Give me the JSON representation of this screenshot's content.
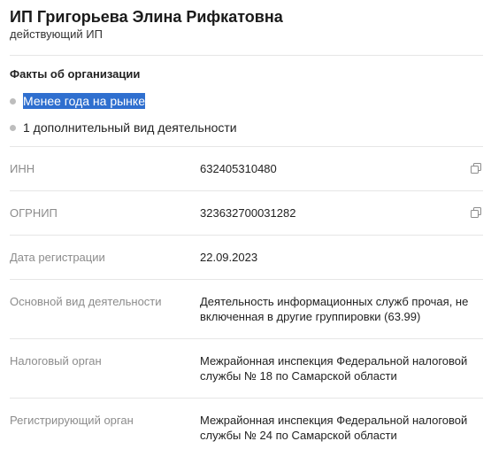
{
  "header": {
    "name": "ИП Григорьева Элина Рифкатовна",
    "status": "действующий ИП"
  },
  "facts": {
    "title": "Факты об организации",
    "items": [
      {
        "text": "Менее года на рынке",
        "selected": true
      },
      {
        "text": "1 дополнительный вид деятельности",
        "selected": false
      }
    ]
  },
  "details": {
    "inn_label": "ИНН",
    "inn_value": "632405310480",
    "ogrnip_label": "ОГРНИП",
    "ogrnip_value": "323632700031282",
    "reg_date_label": "Дата регистрации",
    "reg_date_value": "22.09.2023",
    "activity_label": "Основной вид деятельности",
    "activity_value": "Деятельность информационных служб прочая, не включенная в другие группировки (63.99)",
    "tax_label": "Налоговый орган",
    "tax_value": "Межрайонная инспекция Федеральной налоговой службы № 18 по Самарской области",
    "registrar_label": "Регистрирующий орган",
    "registrar_value": "Межрайонная инспекция Федеральной налоговой службы № 24 по Самарской области"
  },
  "colors": {
    "selection": "#2f6fcf",
    "label": "#8c8c8c",
    "divider": "#e6e6e6"
  },
  "icons": {
    "copy": "copy-icon"
  }
}
